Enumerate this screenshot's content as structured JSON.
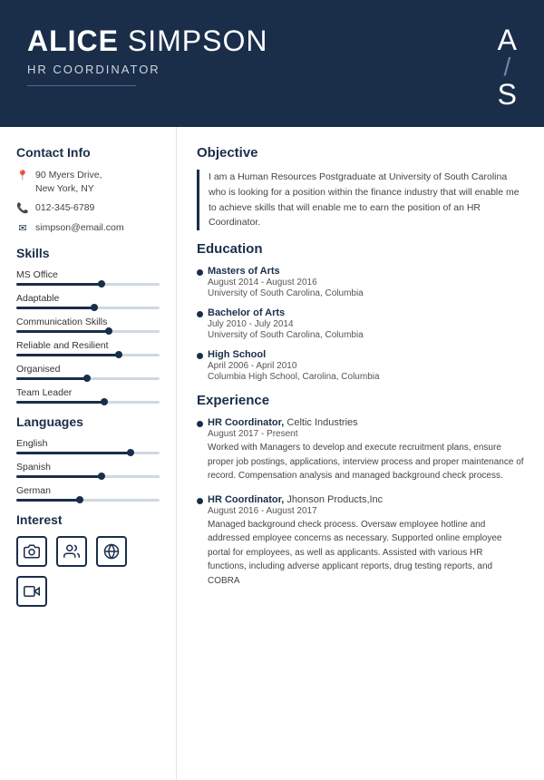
{
  "header": {
    "first_name": "ALICE",
    "last_name": "SIMPSON",
    "title": "HR COORDINATOR",
    "monogram_a": "A",
    "monogram_s": "S",
    "slash": "/"
  },
  "sidebar": {
    "contact_title": "Contact Info",
    "address": "90 Myers Drive,\nNew York, NY",
    "phone": "012-345-6789",
    "email": "simpson@email.com",
    "skills_title": "Skills",
    "skills": [
      {
        "label": "MS Office",
        "fill": 60,
        "dot": 58
      },
      {
        "label": "Adaptable",
        "fill": 55,
        "dot": 53
      },
      {
        "label": "Communication Skills",
        "fill": 65,
        "dot": 63
      },
      {
        "label": "Reliable and Resilient",
        "fill": 70,
        "dot": 68
      },
      {
        "label": "Organised",
        "fill": 50,
        "dot": 48
      },
      {
        "label": "Team Leader",
        "fill": 62,
        "dot": 60
      }
    ],
    "languages_title": "Languages",
    "languages": [
      {
        "label": "English",
        "fill": 80,
        "dot": 78
      },
      {
        "label": "Spanish",
        "fill": 60,
        "dot": 58
      },
      {
        "label": "German",
        "fill": 45,
        "dot": 43
      }
    ],
    "interest_title": "Interest"
  },
  "main": {
    "objective_title": "Objective",
    "objective_text": "I am a Human Resources Postgraduate at University of South Carolina who is looking for a position within the finance industry that will enable me to achieve skills that will enable me to earn the position of an HR Coordinator.",
    "education_title": "Education",
    "education": [
      {
        "degree": "Masters of Arts",
        "date": "August 2014 - August 2016",
        "institution": "University of South Carolina, Columbia"
      },
      {
        "degree": "Bachelor of Arts",
        "date": "July 2010 - July 2014",
        "institution": "University of South Carolina, Columbia"
      },
      {
        "degree": "High School",
        "date": "April 2006 - April 2010",
        "institution": "Columbia High School, Carolina, Columbia"
      }
    ],
    "experience_title": "Experience",
    "experience": [
      {
        "title": "HR Coordinator",
        "company": "Celtic Industries",
        "date": "August 2017 - Present",
        "desc": "Worked with Managers to develop and execute recruitment plans, ensure proper job postings, applications, interview process and proper maintenance of record. Compensation analysis and managed background check process."
      },
      {
        "title": "HR Coordinator",
        "company": "Jhonson Products,Inc",
        "date": "August 2016 - August 2017",
        "desc": "Managed background check process. Oversaw employee hotline and addressed employee concerns as necessary. Supported online employee portal for employees, as well as applicants. Assisted with various HR functions, including adverse applicant reports, drug testing reports, and COBRA"
      }
    ]
  }
}
